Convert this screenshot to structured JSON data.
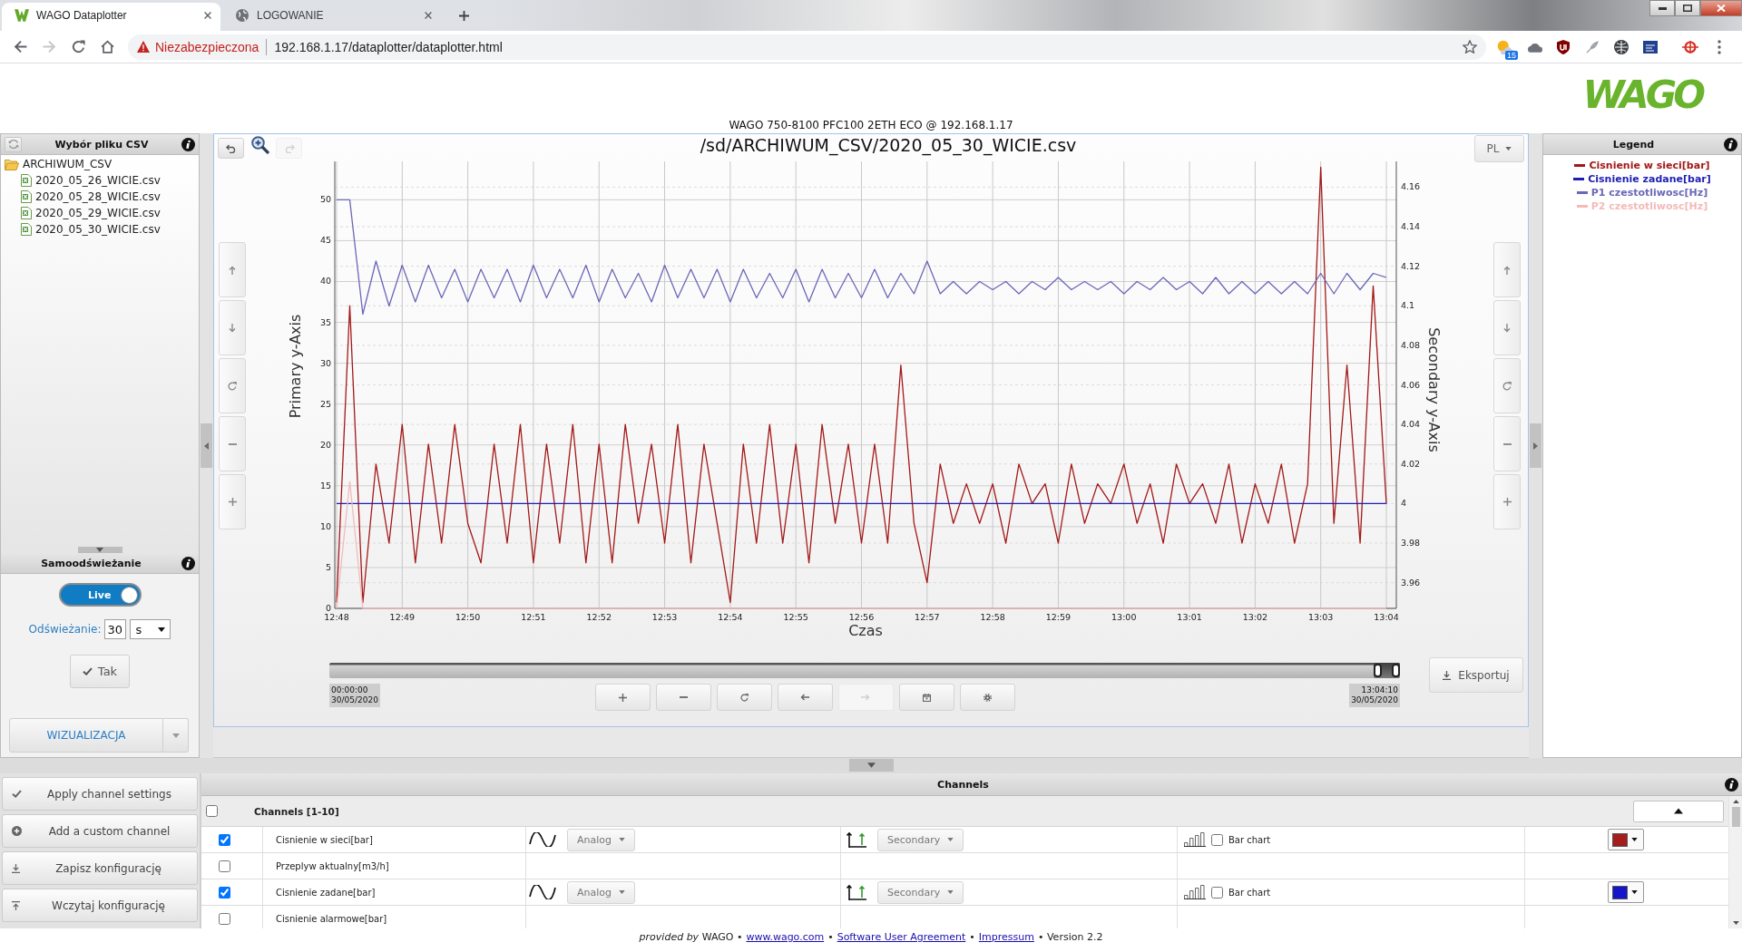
{
  "browser": {
    "tabs": [
      {
        "title": "WAGO Dataplotter",
        "kind": "app",
        "selected": true
      },
      {
        "title": "LOGOWANIE",
        "kind": "web",
        "selected": false
      }
    ],
    "nav": [
      {
        "kind": "back",
        "disabled": false
      },
      {
        "kind": "forward",
        "disabled": true
      },
      {
        "kind": "reload",
        "disabled": false
      },
      {
        "kind": "home",
        "disabled": false
      }
    ],
    "security_label": "Niezabezpieczona",
    "url": "192.168.1.17/dataplotter/dataplotter.html",
    "extension_badge": "15"
  },
  "header": {
    "logo": "WAGO",
    "device_title": "WAGO 750-8100 PFC100 2ETH ECO @ 192.168.1.17"
  },
  "file_panel": {
    "title": "Wybór pliku CSV",
    "tree": [
      {
        "name": "ARCHIWUM_CSV",
        "kind": "folder",
        "expanded": true,
        "children": [
          {
            "name": "2020_05_26_WICIE.csv",
            "kind": "file"
          },
          {
            "name": "2020_05_28_WICIE.csv",
            "kind": "file"
          },
          {
            "name": "2020_05_29_WICIE.csv",
            "kind": "file"
          },
          {
            "name": "2020_05_30_WICIE.csv",
            "kind": "file"
          }
        ]
      }
    ]
  },
  "refresh_panel": {
    "title": "Samoodświeżanie",
    "live_label": "Live",
    "live_on": true,
    "interval_label": "Odświeżanie:",
    "interval_value": "30",
    "interval_unit": "s",
    "confirm_button": "Tak",
    "view_button": "WIZUALIZACJA"
  },
  "plot": {
    "title": "/sd/ARCHIWUM_CSV/2020_05_30_WICIE.csv",
    "undo_disabled": false,
    "redo_disabled": true,
    "language": "PL",
    "chart_data": {
      "type": "line",
      "grid": true,
      "xlabel": "Czas",
      "ylabel": "Primary y-Axis",
      "y2label": "Secondary y-Axis",
      "ylim": [
        0,
        54.7
      ],
      "y2lim": [
        3.947,
        4.173
      ],
      "yticks": [
        0,
        5,
        10,
        15,
        20,
        25,
        30,
        35,
        40,
        45,
        50
      ],
      "y2ticks": [
        3.96,
        3.98,
        4,
        4.02,
        4.04,
        4.06,
        4.08,
        4.1,
        4.12,
        4.14,
        4.16
      ],
      "categories": [
        "12:48",
        null,
        null,
        null,
        null,
        "12:49",
        null,
        null,
        null,
        null,
        "12:50",
        null,
        null,
        null,
        null,
        "12:51",
        null,
        null,
        null,
        null,
        "12:52",
        null,
        null,
        null,
        null,
        "12:53",
        null,
        null,
        null,
        null,
        "12:54",
        null,
        null,
        null,
        null,
        "12:55",
        null,
        null,
        null,
        null,
        "12:56",
        null,
        null,
        null,
        null,
        "12:57",
        null,
        null,
        null,
        null,
        "12:58",
        null,
        null,
        null,
        null,
        "12:59",
        null,
        null,
        null,
        null,
        "13:00",
        null,
        null,
        null,
        null,
        "13:01",
        null,
        null,
        null,
        null,
        "13:02",
        null,
        null,
        null,
        null,
        "13:03",
        null,
        null,
        null,
        null,
        "13:04"
      ],
      "series": [
        {
          "name": "Cisnienie w sieci[bar]",
          "color": "#a31818",
          "axis": "y2",
          "values": [
            3.95,
            4.1,
            3.95,
            4.02,
            3.98,
            4.04,
            3.97,
            4.03,
            3.98,
            4.04,
            3.99,
            3.97,
            4.03,
            3.98,
            4.04,
            3.97,
            4.03,
            3.98,
            4.04,
            3.97,
            4.03,
            3.97,
            4.04,
            3.99,
            4.03,
            3.98,
            4.04,
            3.97,
            4.03,
            3.99,
            3.95,
            4.03,
            3.98,
            4.04,
            3.98,
            4.03,
            3.97,
            4.04,
            3.99,
            4.03,
            3.98,
            4.03,
            3.98,
            4.07,
            3.99,
            3.96,
            4.02,
            3.99,
            4.01,
            3.99,
            4.01,
            3.98,
            4.02,
            4,
            4.01,
            3.98,
            4.02,
            3.99,
            4.01,
            4,
            4.02,
            3.99,
            4.01,
            3.98,
            4.02,
            4,
            4.01,
            3.99,
            4.02,
            3.98,
            4.01,
            3.99,
            4.02,
            3.98,
            4.01,
            4.17,
            3.99,
            4.07,
            3.98,
            4.11,
            4
          ]
        },
        {
          "name": "Cisnienie zadane[bar]",
          "color": "#1e1eb4",
          "axis": "y2",
          "values": [
            4,
            4,
            4,
            4,
            4,
            4,
            4,
            4,
            4,
            4,
            4,
            4,
            4,
            4,
            4,
            4,
            4,
            4,
            4,
            4,
            4,
            4,
            4,
            4,
            4,
            4,
            4,
            4,
            4,
            4,
            4,
            4,
            4,
            4,
            4,
            4,
            4,
            4,
            4,
            4,
            4,
            4,
            4,
            4,
            4,
            4,
            4,
            4,
            4,
            4,
            4,
            4,
            4,
            4,
            4,
            4,
            4,
            4,
            4,
            4,
            4,
            4,
            4,
            4,
            4,
            4,
            4,
            4,
            4,
            4,
            4,
            4,
            4,
            4,
            4,
            4,
            4,
            4,
            4,
            4,
            4
          ]
        },
        {
          "name": "P1 czestotliwosc[Hz]",
          "color": "#6b67b8",
          "values": [
            50,
            50,
            36,
            42.5,
            37,
            42,
            37.5,
            42,
            38,
            41.5,
            37.5,
            41.5,
            38,
            41.5,
            37.5,
            42,
            38,
            41.5,
            38,
            42,
            37.5,
            41.5,
            38,
            41,
            37.5,
            42,
            38,
            41.5,
            38,
            41.5,
            37.5,
            41.5,
            38,
            41,
            38,
            41.5,
            37.5,
            41.5,
            38,
            41,
            38,
            41.5,
            38,
            41,
            38.5,
            42.5,
            38.5,
            40,
            38.5,
            40,
            39,
            40,
            38.5,
            40,
            39,
            40.5,
            39,
            40,
            39,
            40,
            38.5,
            40,
            39,
            40.5,
            39,
            40,
            38.5,
            40.5,
            38.5,
            40,
            38.5,
            40,
            38.5,
            40,
            38.5,
            41,
            38.5,
            41,
            39,
            41,
            40.5
          ]
        },
        {
          "name": "P2 czestotliwosc[Hz]",
          "color": "#f3baba",
          "values": [
            0,
            15.5,
            0,
            0,
            0,
            0,
            0,
            0,
            0,
            0,
            0,
            0,
            0,
            0,
            0,
            0,
            0,
            0,
            0,
            0,
            0,
            0,
            0,
            0,
            0,
            0,
            0,
            0,
            0,
            0,
            0,
            0,
            0,
            0,
            0,
            0,
            0,
            0,
            0,
            0,
            0,
            0,
            0,
            0,
            0,
            0,
            0,
            0,
            0,
            0,
            0,
            0,
            0,
            0,
            0,
            0,
            0,
            0,
            0,
            0,
            0,
            0,
            0,
            0,
            0,
            0,
            0,
            0,
            0,
            0,
            0,
            0,
            0,
            0,
            0,
            0,
            0,
            0,
            0,
            0,
            0
          ]
        }
      ]
    },
    "range": {
      "level": 0.975,
      "start_time": "00:00:00",
      "start_date": "30/05/2020",
      "end_time": "13:04:10",
      "end_date": "30/05/2020"
    },
    "controls": [
      {
        "kind": "zoom-in",
        "disabled": false
      },
      {
        "kind": "zoom-out",
        "disabled": false
      },
      {
        "kind": "reset",
        "disabled": false
      },
      {
        "kind": "back",
        "disabled": false
      },
      {
        "kind": "forward",
        "disabled": true
      },
      {
        "kind": "calendar",
        "disabled": false
      },
      {
        "kind": "settings",
        "disabled": false
      }
    ],
    "export_button": "Eksportuj"
  },
  "legend": {
    "title": "Legend"
  },
  "channel_actions": [
    {
      "kind": "apply",
      "label": "Apply channel settings"
    },
    {
      "kind": "add",
      "label": "Add a custom channel"
    },
    {
      "kind": "save",
      "label": "Zapisz konfigurację"
    },
    {
      "kind": "load",
      "label": "Wczytaj konfigurację"
    }
  ],
  "channels": {
    "title": "Channels",
    "group": {
      "label": "Channels [1-10]",
      "checked": false,
      "expanded": true
    },
    "rows": [
      {
        "checked": true,
        "name": "Cisnienie w sieci[bar]",
        "signal": "Analog",
        "axis": "Secondary",
        "bar_chart": {
          "label": "Bar chart",
          "checked": false
        },
        "color": "#a51c1c"
      },
      {
        "checked": false,
        "name": "Przeplyw aktualny[m3/h]"
      },
      {
        "checked": true,
        "name": "Cisnienie zadane[bar]",
        "signal": "Analog",
        "axis": "Secondary",
        "bar_chart": {
          "label": "Bar chart",
          "checked": false
        },
        "color": "#1414c8"
      },
      {
        "checked": false,
        "name": "Cisnienie alarmowe[bar]"
      }
    ]
  },
  "footer": [
    {
      "kind": "text",
      "text": "*provided by* WAGO •"
    },
    {
      "kind": "link",
      "text": "www.wago.com"
    },
    {
      "kind": "text",
      "text": "•"
    },
    {
      "kind": "link",
      "text": "Software User Agreement"
    },
    {
      "kind": "text",
      "text": "•"
    },
    {
      "kind": "link",
      "text": "Impressum"
    },
    {
      "kind": "text",
      "text": "• Version 2.2"
    }
  ]
}
